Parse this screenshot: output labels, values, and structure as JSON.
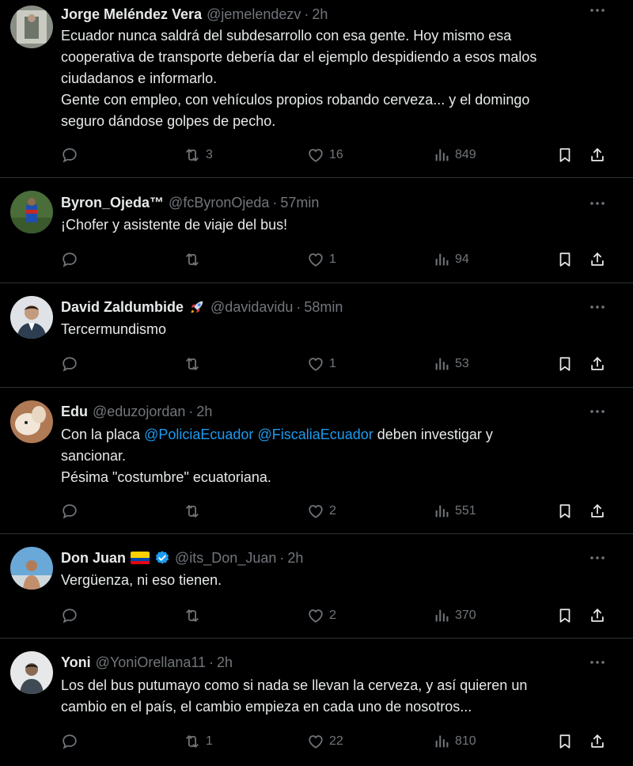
{
  "tweets": [
    {
      "name": "Jorge Meléndez Vera",
      "handle": "@jemelendezv",
      "time": "2h",
      "lines": [
        "Ecuador nunca saldrá del subdesarrollo con esa gente. Hoy mismo esa",
        "cooperativa de transporte debería dar el ejemplo despidiendo a esos malos",
        "ciudadanos e informarlo.",
        "Gente con empleo, con vehículos propios robando cerveza... y el domingo",
        "seguro dándose golpes de pecho."
      ],
      "retweets": "3",
      "likes": "16",
      "views": "849"
    },
    {
      "name": "Byron_Ojeda™",
      "handle": "@fcByronOjeda",
      "time": "57min",
      "lines": [
        "¡Chofer y asistente de viaje del bus!"
      ],
      "retweets": "",
      "likes": "1",
      "views": "94"
    },
    {
      "name": "David Zaldumbide",
      "handle": "@davidavidu",
      "time": "58min",
      "lines": [
        "Tercermundismo"
      ],
      "retweets": "",
      "likes": "1",
      "views": "53"
    },
    {
      "name": "Edu",
      "handle": "@eduzojordan",
      "time": "2h",
      "line1_pre": "Con la placa ",
      "mention1": "@PoliciaEcuador",
      "line1_mid": " ",
      "mention2": "@FiscaliaEcuador",
      "line1_post": " deben investigar y",
      "lines": [
        "sancionar.",
        "Pésima \"costumbre\" ecuatoriana."
      ],
      "retweets": "",
      "likes": "2",
      "views": "551"
    },
    {
      "name": "Don Juan",
      "handle": "@its_Don_Juan",
      "time": "2h",
      "lines": [
        "Vergüenza, ni eso tienen."
      ],
      "retweets": "",
      "likes": "2",
      "views": "370"
    },
    {
      "name": "Yoni",
      "handle": "@YoniOrellana11",
      "time": "2h",
      "lines": [
        "Los del bus putumayo como si nada se llevan la cerveza, y así quieren un",
        "cambio en el país, el cambio empieza en cada uno de nosotros..."
      ],
      "retweets": "1",
      "likes": "22",
      "views": "810"
    }
  ],
  "separator": "·",
  "icons": {
    "reply": "reply-icon",
    "retweet": "retweet-icon",
    "like": "heart-icon",
    "views": "views-icon",
    "bookmark": "bookmark-icon",
    "share": "share-icon",
    "more": "more-icon",
    "verified": "verified-icon",
    "flag": "ecuador-flag-icon",
    "rocket": "rocket-icon"
  },
  "colors": {
    "background": "#000000",
    "text": "#e7e9ea",
    "muted": "#71767b",
    "link": "#1d9bf0",
    "divider": "#2f3336"
  }
}
